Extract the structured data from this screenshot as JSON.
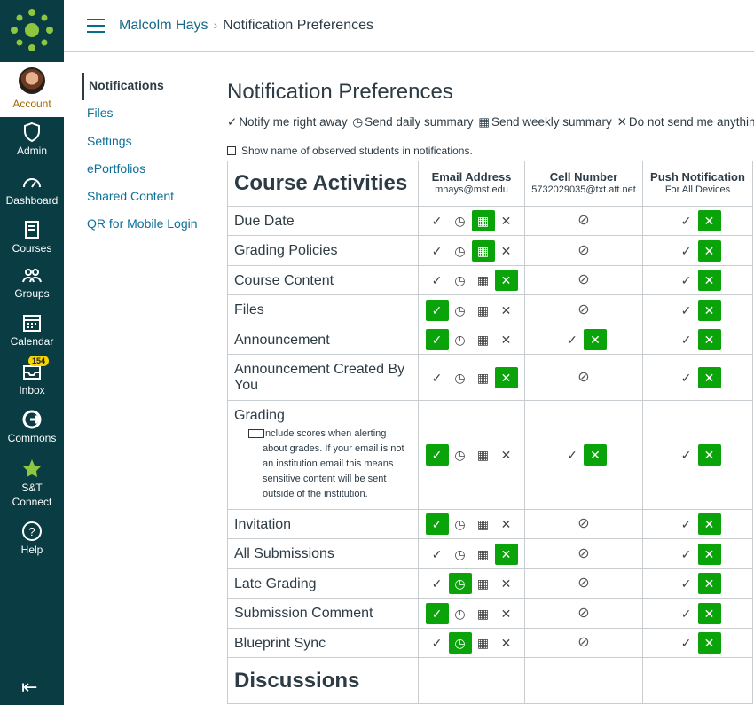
{
  "nav": [
    {
      "key": "account",
      "label": "Account",
      "icon": "avatar-icon",
      "active": true
    },
    {
      "key": "admin",
      "label": "Admin",
      "icon": "shield-icon"
    },
    {
      "key": "dashboard",
      "label": "Dashboard",
      "icon": "dashboard-icon"
    },
    {
      "key": "courses",
      "label": "Courses",
      "icon": "book-icon"
    },
    {
      "key": "groups",
      "label": "Groups",
      "icon": "groups-icon"
    },
    {
      "key": "calendar",
      "label": "Calendar",
      "icon": "calendar-icon"
    },
    {
      "key": "inbox",
      "label": "Inbox",
      "icon": "inbox-icon",
      "badge": "154"
    },
    {
      "key": "commons",
      "label": "Commons",
      "icon": "commons-icon"
    },
    {
      "key": "stconnect",
      "label": "S&T Connect",
      "icon": "star-icon"
    },
    {
      "key": "help",
      "label": "Help",
      "icon": "help-icon"
    }
  ],
  "breadcrumb": {
    "user": "Malcolm Hays",
    "page": "Notification Preferences"
  },
  "subnav": [
    "Notifications",
    "Files",
    "Settings",
    "ePortfolios",
    "Shared Content",
    "QR for Mobile Login"
  ],
  "title": "Notification Preferences",
  "legend": {
    "immediately": "Notify me right away",
    "daily": "Send daily summary",
    "weekly": "Send weekly summary",
    "never": "Do not send me anything"
  },
  "show_observed": "Show name of observed students in notifications.",
  "section_title": "Course Activities",
  "next_section": "Discussions",
  "channels": [
    {
      "name": "Email Address",
      "address": "mhays@mst.edu"
    },
    {
      "name": "Cell Number",
      "address": "5732029035@txt.att.net"
    },
    {
      "name": "Push Notification",
      "address": "For All Devices"
    }
  ],
  "grading_note": "Include scores when alerting about grades. If your email is not an institution email this means sensitive content will be sent outside of the institution.",
  "categories": [
    {
      "name": "Due Date",
      "email": "weekly",
      "sms": "off",
      "push": "never"
    },
    {
      "name": "Grading Policies",
      "email": "weekly",
      "sms": "off",
      "push": "never"
    },
    {
      "name": "Course Content",
      "email": "never",
      "sms": "off",
      "push": "never"
    },
    {
      "name": "Files",
      "email": "immediately",
      "sms": "off",
      "push": "never"
    },
    {
      "name": "Announcement",
      "email": "immediately",
      "sms": "never",
      "push": "never"
    },
    {
      "name": "Announcement Created By You",
      "email": "never",
      "sms": "off",
      "push": "never"
    },
    {
      "name": "Grading",
      "email": "immediately",
      "sms": "never",
      "push": "never",
      "note": true
    },
    {
      "name": "Invitation",
      "email": "immediately",
      "sms": "off",
      "push": "never"
    },
    {
      "name": "All Submissions",
      "email": "never",
      "sms": "off",
      "push": "never"
    },
    {
      "name": "Late Grading",
      "email": "daily",
      "sms": "off",
      "push": "never"
    },
    {
      "name": "Submission Comment",
      "email": "immediately",
      "sms": "off",
      "push": "never"
    },
    {
      "name": "Blueprint Sync",
      "email": "daily",
      "sms": "off",
      "push": "never"
    }
  ],
  "colors": {
    "nav_bg": "#0a3c43",
    "selected": "#0aa40a",
    "link": "#0d6f98",
    "account_active": "#9e6a00"
  }
}
